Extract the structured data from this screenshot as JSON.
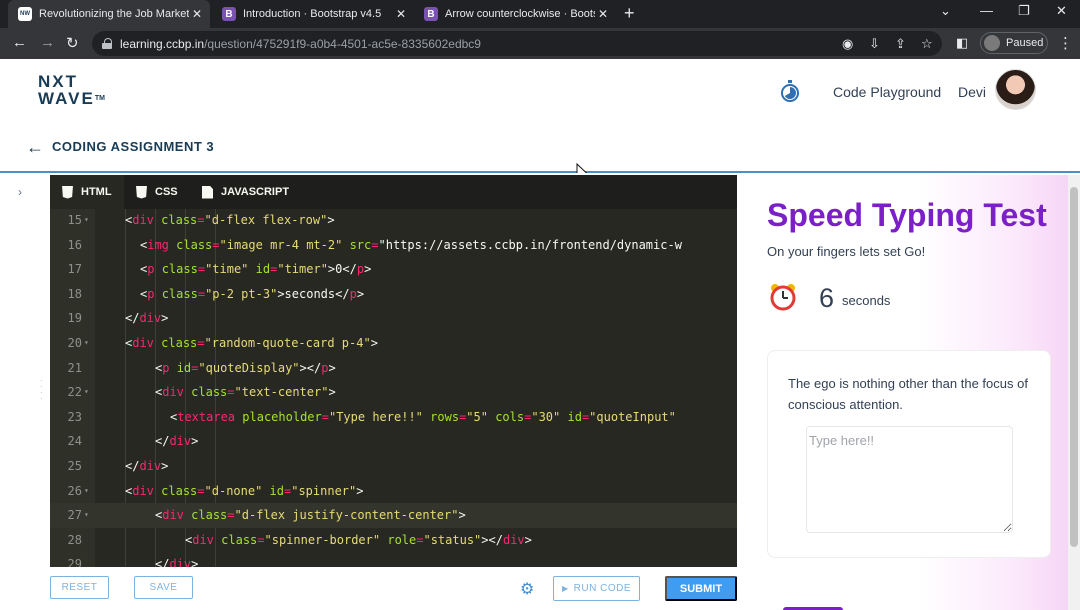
{
  "browser": {
    "tabs": [
      {
        "title": "Revolutionizing the Job Market | ",
        "active": true
      },
      {
        "title": "Introduction · Bootstrap v4.5",
        "active": false
      },
      {
        "title": "Arrow counterclockwise · Bootstr",
        "active": false
      }
    ],
    "url_host": "learning.ccbp.in",
    "url_path": "/question/475291f9-a0b4-4501-ac5e-8335602edbc9",
    "profile_status": "Paused"
  },
  "header": {
    "logo_line1": "NXT",
    "logo_line2": "WAVE",
    "logo_tm": "TM",
    "playground_link": "Code Playground",
    "user_name": "Devi",
    "back_title": "CODING ASSIGNMENT 3"
  },
  "editor": {
    "tabs": [
      {
        "label": "HTML",
        "active": true
      },
      {
        "label": "CSS",
        "active": false
      },
      {
        "label": "JAVASCRIPT",
        "active": false
      }
    ],
    "lines": [
      {
        "num": "15",
        "fold": true,
        "code": "<div class=\"d-flex flex-row\">"
      },
      {
        "num": "16",
        "fold": false,
        "code": "<img class=\"image mr-4 mt-2\" src=\"https://assets.ccbp.in/frontend/dynamic-w"
      },
      {
        "num": "17",
        "fold": false,
        "code": "<p class=\"time\" id=\"timer\">0</p>"
      },
      {
        "num": "18",
        "fold": false,
        "code": "<p class=\"p-2 pt-3\">seconds</p>"
      },
      {
        "num": "19",
        "fold": false,
        "code": "</div>"
      },
      {
        "num": "20",
        "fold": true,
        "code": "<div class=\"random-quote-card p-4\">"
      },
      {
        "num": "21",
        "fold": false,
        "code": "<p id=\"quoteDisplay\"></p>"
      },
      {
        "num": "22",
        "fold": true,
        "code": "<div class=\"text-center\">"
      },
      {
        "num": "23",
        "fold": false,
        "code": "<textarea placeholder=\"Type here!!\" rows=\"5\" cols=\"30\" id=\"quoteInput\""
      },
      {
        "num": "24",
        "fold": false,
        "code": "</div>"
      },
      {
        "num": "25",
        "fold": false,
        "code": "</div>"
      },
      {
        "num": "26",
        "fold": true,
        "code": "<div class=\"d-none\" id=\"spinner\">"
      },
      {
        "num": "27",
        "fold": true,
        "code": "<div class=\"d-flex justify-content-center\">"
      },
      {
        "num": "28",
        "fold": false,
        "code": "<div class=\"spinner-border\" role=\"status\"></div>"
      },
      {
        "num": "29",
        "fold": false,
        "code": "</div>"
      }
    ],
    "reset_label": "RESET",
    "save_label": "SAVE",
    "run_label": "RUN CODE",
    "submit_label": "SUBMIT"
  },
  "preview": {
    "title": "Speed Typing Test",
    "subtitle": "On your fingers lets set Go!",
    "timer_value": "6",
    "timer_unit": "seconds",
    "quote": "The ego is nothing other than the focus of conscious attention.",
    "input_placeholder": "Type here!!"
  }
}
